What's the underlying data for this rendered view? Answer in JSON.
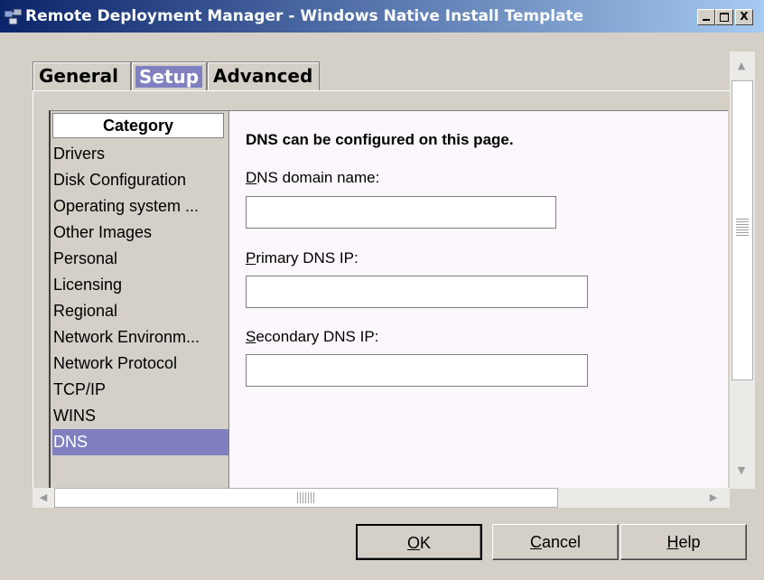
{
  "window": {
    "title": "Remote Deployment Manager - Windows Native Install Template",
    "controls": {
      "minimize": "_",
      "maximize": "□",
      "close": "X"
    }
  },
  "tabs": [
    {
      "label": "General",
      "selected": false
    },
    {
      "label": "Setup",
      "selected": true
    },
    {
      "label": "Advanced",
      "selected": false
    }
  ],
  "category": {
    "header": "Category",
    "items": [
      "Drivers",
      "Disk Configuration",
      "Operating system ...",
      "Other Images",
      "Personal",
      "Licensing",
      "Regional",
      "Network Environm...",
      "Network Protocol",
      "TCP/IP",
      "WINS",
      "DNS"
    ],
    "selected": "DNS"
  },
  "dns": {
    "intro": "DNS can be configured on this page.",
    "domain_label_ul": "D",
    "domain_label_rest": "NS domain name:",
    "domain_value": "",
    "primary_label_ul": "P",
    "primary_label_rest": "rimary DNS IP:",
    "primary_value": "",
    "secondary_label_ul": "S",
    "secondary_label_rest": "econdary DNS IP:",
    "secondary_value": ""
  },
  "buttons": {
    "ok_ul": "O",
    "ok_rest": "K",
    "cancel_ul": "C",
    "cancel_rest": "ancel",
    "help_ul": "H",
    "help_rest": "elp"
  },
  "colors": {
    "selection": "#8080c0",
    "panel_bg": "#d4d0c8",
    "detail_bg": "#fcf7fc",
    "title_start": "#0a246a",
    "title_end": "#a6caf0"
  }
}
